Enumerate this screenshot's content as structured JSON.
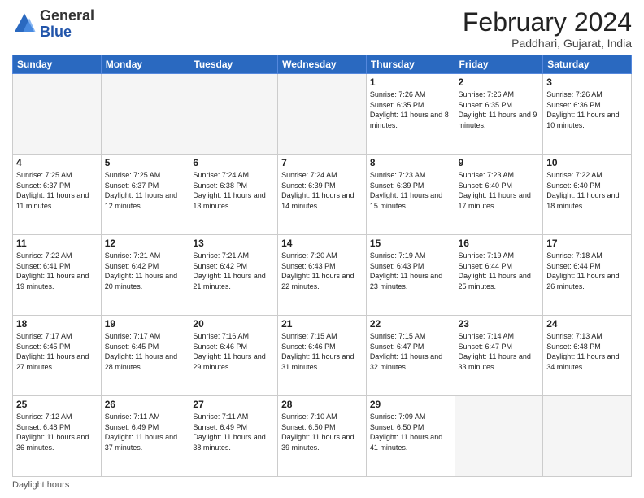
{
  "logo": {
    "general": "General",
    "blue": "Blue"
  },
  "header": {
    "month_year": "February 2024",
    "location": "Paddhari, Gujarat, India"
  },
  "days_of_week": [
    "Sunday",
    "Monday",
    "Tuesday",
    "Wednesday",
    "Thursday",
    "Friday",
    "Saturday"
  ],
  "footer": {
    "label": "Daylight hours"
  },
  "weeks": [
    [
      {
        "day": "",
        "empty": true
      },
      {
        "day": "",
        "empty": true
      },
      {
        "day": "",
        "empty": true
      },
      {
        "day": "",
        "empty": true
      },
      {
        "day": "1",
        "sunrise": "7:26 AM",
        "sunset": "6:35 PM",
        "daylight": "11 hours and 8 minutes."
      },
      {
        "day": "2",
        "sunrise": "7:26 AM",
        "sunset": "6:35 PM",
        "daylight": "11 hours and 9 minutes."
      },
      {
        "day": "3",
        "sunrise": "7:26 AM",
        "sunset": "6:36 PM",
        "daylight": "11 hours and 10 minutes."
      }
    ],
    [
      {
        "day": "4",
        "sunrise": "7:25 AM",
        "sunset": "6:37 PM",
        "daylight": "11 hours and 11 minutes."
      },
      {
        "day": "5",
        "sunrise": "7:25 AM",
        "sunset": "6:37 PM",
        "daylight": "11 hours and 12 minutes."
      },
      {
        "day": "6",
        "sunrise": "7:24 AM",
        "sunset": "6:38 PM",
        "daylight": "11 hours and 13 minutes."
      },
      {
        "day": "7",
        "sunrise": "7:24 AM",
        "sunset": "6:39 PM",
        "daylight": "11 hours and 14 minutes."
      },
      {
        "day": "8",
        "sunrise": "7:23 AM",
        "sunset": "6:39 PM",
        "daylight": "11 hours and 15 minutes."
      },
      {
        "day": "9",
        "sunrise": "7:23 AM",
        "sunset": "6:40 PM",
        "daylight": "11 hours and 17 minutes."
      },
      {
        "day": "10",
        "sunrise": "7:22 AM",
        "sunset": "6:40 PM",
        "daylight": "11 hours and 18 minutes."
      }
    ],
    [
      {
        "day": "11",
        "sunrise": "7:22 AM",
        "sunset": "6:41 PM",
        "daylight": "11 hours and 19 minutes."
      },
      {
        "day": "12",
        "sunrise": "7:21 AM",
        "sunset": "6:42 PM",
        "daylight": "11 hours and 20 minutes."
      },
      {
        "day": "13",
        "sunrise": "7:21 AM",
        "sunset": "6:42 PM",
        "daylight": "11 hours and 21 minutes."
      },
      {
        "day": "14",
        "sunrise": "7:20 AM",
        "sunset": "6:43 PM",
        "daylight": "11 hours and 22 minutes."
      },
      {
        "day": "15",
        "sunrise": "7:19 AM",
        "sunset": "6:43 PM",
        "daylight": "11 hours and 23 minutes."
      },
      {
        "day": "16",
        "sunrise": "7:19 AM",
        "sunset": "6:44 PM",
        "daylight": "11 hours and 25 minutes."
      },
      {
        "day": "17",
        "sunrise": "7:18 AM",
        "sunset": "6:44 PM",
        "daylight": "11 hours and 26 minutes."
      }
    ],
    [
      {
        "day": "18",
        "sunrise": "7:17 AM",
        "sunset": "6:45 PM",
        "daylight": "11 hours and 27 minutes."
      },
      {
        "day": "19",
        "sunrise": "7:17 AM",
        "sunset": "6:45 PM",
        "daylight": "11 hours and 28 minutes."
      },
      {
        "day": "20",
        "sunrise": "7:16 AM",
        "sunset": "6:46 PM",
        "daylight": "11 hours and 29 minutes."
      },
      {
        "day": "21",
        "sunrise": "7:15 AM",
        "sunset": "6:46 PM",
        "daylight": "11 hours and 31 minutes."
      },
      {
        "day": "22",
        "sunrise": "7:15 AM",
        "sunset": "6:47 PM",
        "daylight": "11 hours and 32 minutes."
      },
      {
        "day": "23",
        "sunrise": "7:14 AM",
        "sunset": "6:47 PM",
        "daylight": "11 hours and 33 minutes."
      },
      {
        "day": "24",
        "sunrise": "7:13 AM",
        "sunset": "6:48 PM",
        "daylight": "11 hours and 34 minutes."
      }
    ],
    [
      {
        "day": "25",
        "sunrise": "7:12 AM",
        "sunset": "6:48 PM",
        "daylight": "11 hours and 36 minutes."
      },
      {
        "day": "26",
        "sunrise": "7:11 AM",
        "sunset": "6:49 PM",
        "daylight": "11 hours and 37 minutes."
      },
      {
        "day": "27",
        "sunrise": "7:11 AM",
        "sunset": "6:49 PM",
        "daylight": "11 hours and 38 minutes."
      },
      {
        "day": "28",
        "sunrise": "7:10 AM",
        "sunset": "6:50 PM",
        "daylight": "11 hours and 39 minutes."
      },
      {
        "day": "29",
        "sunrise": "7:09 AM",
        "sunset": "6:50 PM",
        "daylight": "11 hours and 41 minutes."
      },
      {
        "day": "",
        "empty": true
      },
      {
        "day": "",
        "empty": true
      }
    ]
  ]
}
